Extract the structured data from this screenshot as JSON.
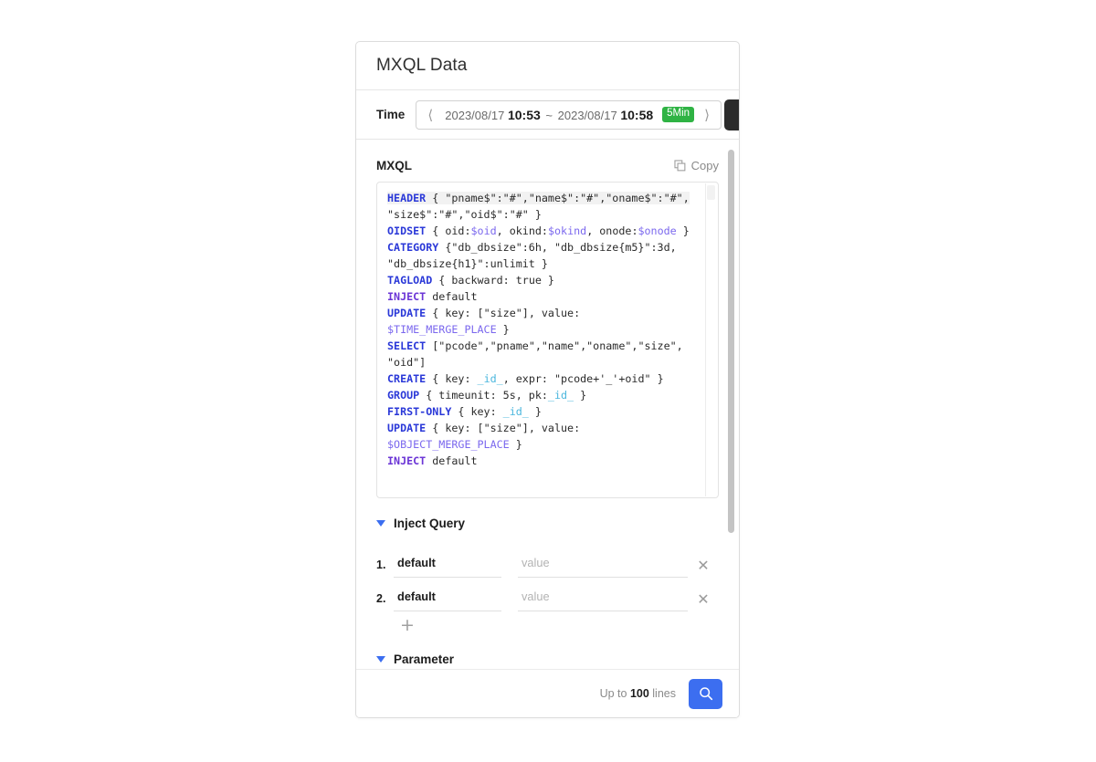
{
  "modal": {
    "title": "MXQL Data"
  },
  "time": {
    "label": "Time",
    "prev_icon": "chevron-left-icon",
    "next_icon": "chevron-right-icon",
    "start_date": "2023/08/17",
    "start_time": "10:53",
    "separator": "~",
    "end_date": "2023/08/17",
    "end_time": "10:58",
    "interval_badge": "5Min"
  },
  "mxql": {
    "section_label": "MXQL",
    "copy_label": "Copy",
    "lines": [
      {
        "kw": "HEADER",
        "kw_style": "k",
        "highlight": true,
        "rest": " { \"pname$\":\"#\",\"name$\":\"#\",\"oname$\":\"#\","
      },
      {
        "kw": "",
        "rest": "\"size$\":\"#\",\"oid$\":\"#\" }"
      },
      {
        "kw": "OIDSET",
        "kw_style": "k",
        "rest": " { oid:$oid, okind:$okind, onode:$onode }"
      },
      {
        "kw": "CATEGORY",
        "kw_style": "k",
        "rest": " {\"db_dbsize\":6h, \"db_dbsize{m5}\":3d,"
      },
      {
        "kw": "",
        "rest": "\"db_dbsize{h1}\":unlimit }"
      },
      {
        "kw": "TAGLOAD",
        "kw_style": "k",
        "rest": " { backward: true }"
      },
      {
        "kw": "INJECT",
        "kw_style": "kp",
        "rest": " default"
      },
      {
        "kw": "UPDATE",
        "kw_style": "k",
        "rest": " { key: [\"size\"], value:"
      },
      {
        "kw": "$TIME_MERGE_PLACE",
        "kw_style": "vp",
        "rest": " }"
      },
      {
        "kw": "SELECT",
        "kw_style": "k",
        "rest": " [\"pcode\",\"pname\",\"name\",\"oname\",\"size\","
      },
      {
        "kw": "",
        "rest": "\"oid\"]"
      },
      {
        "kw": "CREATE",
        "kw_style": "k",
        "rest": " { key: _id_, expr: \"pcode+'_'+oid\" }"
      },
      {
        "kw": "GROUP",
        "kw_style": "k",
        "rest": " { timeunit: 5s, pk:_id_ }"
      },
      {
        "kw": "FIRST-ONLY",
        "kw_style": "k",
        "rest": " { key: _id_ }"
      },
      {
        "kw": "UPDATE",
        "kw_style": "k",
        "rest": " { key: [\"size\"], value:"
      },
      {
        "kw": "$OBJECT_MERGE_PLACE",
        "kw_style": "vp",
        "rest": " }"
      },
      {
        "kw": "INJECT",
        "kw_style": "kp",
        "rest": " default"
      }
    ],
    "raw": "HEADER { \"pname$\":\"#\",\"name$\":\"#\",\"oname$\":\"#\",\"size$\":\"#\",\"oid$\":\"#\" }\nOIDSET { oid:$oid, okind:$okind, onode:$onode }\nCATEGORY {\"db_dbsize\":6h, \"db_dbsize{m5}\":3d, \"db_dbsize{h1}\":unlimit }\nTAGLOAD { backward: true }\nINJECT default\nUPDATE { key: [\"size\"], value: $TIME_MERGE_PLACE }\nSELECT [\"pcode\",\"pname\",\"name\",\"oname\",\"size\",\"oid\"]\nCREATE { key: _id_, expr: \"pcode+'_'+oid\" }\nGROUP { timeunit: 5s, pk:_id_ }\nFIRST-ONLY { key: _id_ }\nUPDATE { key: [\"size\"], value: $OBJECT_MERGE_PLACE }\nINJECT default"
  },
  "inject_query": {
    "title": "Inject Query",
    "rows": [
      {
        "index": "1.",
        "key": "default",
        "value": "",
        "value_placeholder": "value",
        "delete_icon": "close-icon"
      },
      {
        "index": "2.",
        "key": "default",
        "value": "",
        "value_placeholder": "value",
        "delete_icon": "close-icon"
      }
    ],
    "add_label": "+"
  },
  "parameter": {
    "title": "Parameter"
  },
  "footer": {
    "lines_prefix": "Up to",
    "lines_count": "100",
    "lines_suffix": "lines",
    "search_icon": "search-icon"
  },
  "colors": {
    "accent_blue": "#3c6ef0",
    "badge_green": "#2fb344",
    "keyword_blue": "#2a38d8",
    "keyword_purple": "#6b35d6",
    "variable_purple": "#7b68ee",
    "id_cyan": "#49b6dd"
  }
}
